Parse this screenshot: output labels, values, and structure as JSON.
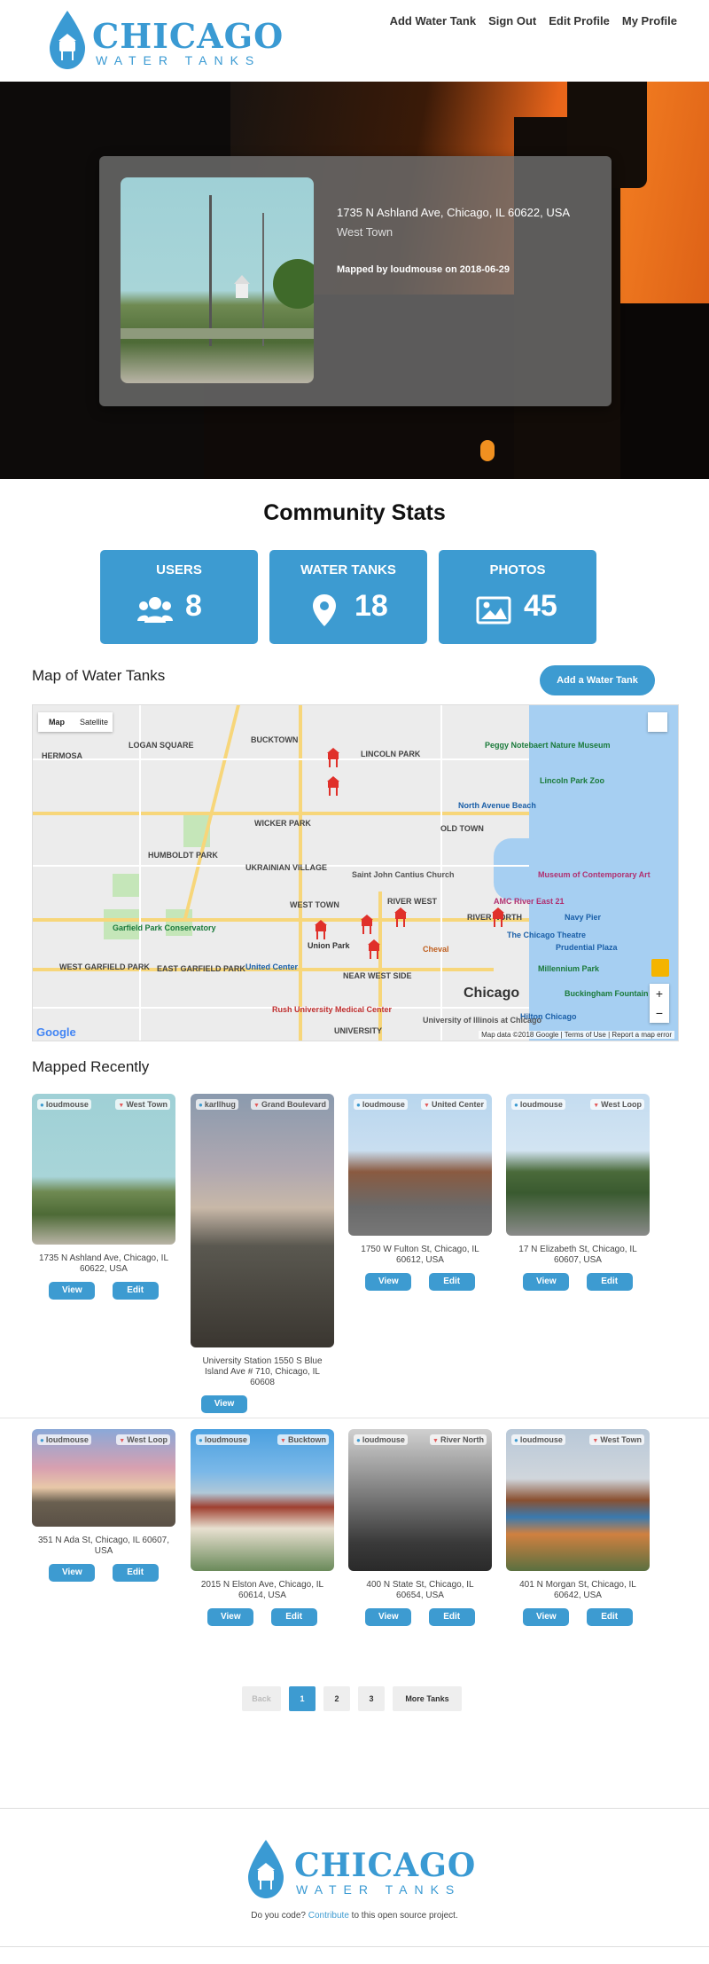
{
  "brand": {
    "word": "CHICAGO",
    "sub": "WATER TANKS"
  },
  "nav": [
    {
      "label": "Add Water Tank"
    },
    {
      "label": "Sign Out"
    },
    {
      "label": "Edit Profile"
    },
    {
      "label": "My Profile"
    }
  ],
  "hero": {
    "address": "1735 N Ashland Ave, Chicago, IL 60622, USA",
    "neighborhood": "West Town",
    "mapped_by": "Mapped by loudmouse on 2018-06-29"
  },
  "stats": {
    "title": "Community Stats",
    "users": {
      "label": "USERS",
      "value": "8",
      "icon": "users-icon"
    },
    "tanks": {
      "label": "WATER TANKS",
      "value": "18",
      "icon": "map-pin-icon"
    },
    "photos": {
      "label": "PHOTOS",
      "value": "45",
      "icon": "image-icon"
    }
  },
  "map_section": {
    "title": "Map of Water Tanks",
    "add_button": "Add a Water Tank",
    "map_type_map": "Map",
    "map_type_satellite": "Satellite",
    "labels": {
      "hermosa": "HERMOSA",
      "logan_square": "LOGAN SQUARE",
      "bucktown": "BUCKTOWN",
      "lincoln_park": "LINCOLN PARK",
      "wicker_park": "WICKER PARK",
      "old_town": "OLD TOWN",
      "humboldt_park": "HUMBOLDT PARK",
      "ukrainian_village": "UKRAINIAN VILLAGE",
      "west_town": "WEST TOWN",
      "river_west": "RIVER WEST",
      "river_north": "RIVER NORTH",
      "west_garfield_park": "WEST GARFIELD PARK",
      "east_garfield_park": "EAST GARFIELD PARK",
      "near_west_side": "NEAR WEST SIDE",
      "ukrainian": "UNIVERSITY",
      "lincoln_park_zoo": "Lincoln Park Zoo",
      "north_avenue_beach": "North Avenue Beach",
      "navy_pier": "Navy Pier",
      "chicago_theatre": "The Chicago Theatre",
      "millennium_park": "Millennium Park",
      "buckingham_fountain": "Buckingham Fountain",
      "united_center": "United Center",
      "rush": "Rush University Medical Center",
      "garfield_conservatory": "Garfield Park Conservatory",
      "union_park": "Union Park",
      "peggy": "Peggy Notebaert Nature Museum",
      "mca": "Museum of Contemporary Art",
      "amc": "AMC River East 21",
      "prudential": "Prudential Plaza",
      "hilton": "Hilton Chicago",
      "uic": "University of Illinois at Chicago",
      "saint_john": "Saint John Cantius Church",
      "cheval": "Cheval"
    },
    "city": "Chicago",
    "zoom_in": "+",
    "zoom_out": "−",
    "google": "Google",
    "attribution": "Map data ©2018 Google | Terms of Use | Report a map error"
  },
  "recent": {
    "title": "Mapped Recently",
    "tiles": [
      {
        "user": "loudmouse",
        "hood": "West Town",
        "address": "1735 N Ashland Ave, Chicago, IL 60622, USA",
        "view": "View",
        "edit": "Edit"
      },
      {
        "user": "karllhug",
        "hood": "Grand Boulevard",
        "address": "University Station 1550 S Blue Island Ave # 710, Chicago, IL 60608",
        "view": "View"
      },
      {
        "user": "loudmouse",
        "hood": "United Center",
        "address": "1750 W Fulton St, Chicago, IL 60612, USA",
        "view": "View",
        "edit": "Edit"
      },
      {
        "user": "loudmouse",
        "hood": "West Loop",
        "address": "17 N Elizabeth St, Chicago, IL 60607, USA",
        "view": "View",
        "edit": "Edit"
      },
      {
        "user": "loudmouse",
        "hood": "West Loop",
        "address": "351 N Ada St, Chicago, IL 60607, USA",
        "view": "View",
        "edit": "Edit"
      },
      {
        "user": "loudmouse",
        "hood": "Bucktown",
        "address": "2015 N Elston Ave, Chicago, IL 60614, USA",
        "view": "View",
        "edit": "Edit"
      },
      {
        "user": "loudmouse",
        "hood": "River North",
        "address": "400 N State St, Chicago, IL 60654, USA",
        "view": "View",
        "edit": "Edit"
      },
      {
        "user": "loudmouse",
        "hood": "West Town",
        "address": "401 N Morgan St, Chicago, IL 60642, USA",
        "view": "View",
        "edit": "Edit"
      }
    ]
  },
  "pager": {
    "back": "Back",
    "p1": "1",
    "p2": "2",
    "p3": "3",
    "more": "More Tanks"
  },
  "footer": {
    "prefix": "Do you code?",
    "link": "Contribute",
    "suffix": "to this open source project."
  }
}
